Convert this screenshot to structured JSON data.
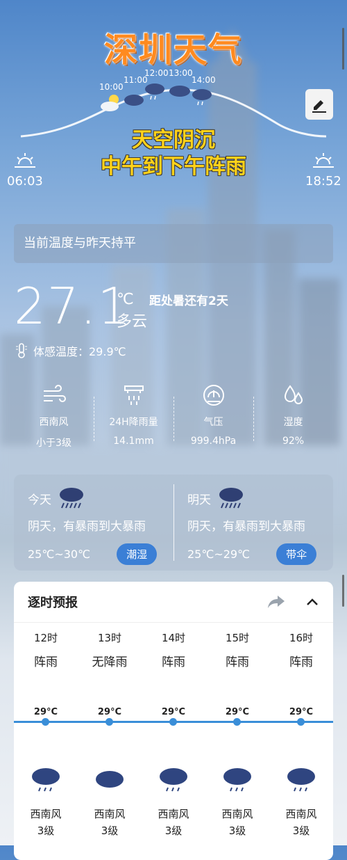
{
  "banner": {
    "title": "深圳天气",
    "headline_line1": "天空阴沉",
    "headline_line2": "中午到下午阵雨"
  },
  "timeline": [
    "10:00",
    "11:00",
    "12:00",
    "13:00",
    "14:00"
  ],
  "sun": {
    "sunrise": "06:03",
    "sunset": "18:52"
  },
  "compare_text": "当前温度与昨天持平",
  "current": {
    "temperature": "27.1",
    "unit": "℃",
    "condition": "多云",
    "solar_term": "距处暑还有2天",
    "feels_like": "体感温度：29.9℃"
  },
  "metrics": [
    {
      "label": "西南风",
      "value": "小于3级",
      "icon": "wind-icon"
    },
    {
      "label": "24H降雨量",
      "value": "14.1mm",
      "icon": "rain-gauge-icon"
    },
    {
      "label": "气压",
      "value": "999.4hPa",
      "icon": "pressure-gauge-icon"
    },
    {
      "label": "湿度",
      "value": "92%",
      "icon": "humidity-drops-icon"
    }
  ],
  "days": [
    {
      "name": "今天",
      "desc": "阴天，有暴雨到大暴雨",
      "range": "25℃~30℃",
      "tag": "潮湿",
      "icon": "heavy-rain-icon"
    },
    {
      "name": "明天",
      "desc": "阴天，有暴雨到大暴雨",
      "range": "25℃~29℃",
      "tag": "带伞",
      "icon": "heavy-rain-icon"
    }
  ],
  "hourly": {
    "title": "逐时预报",
    "items": [
      {
        "time": "12时",
        "cond": "阵雨",
        "temp": "29°C",
        "wind": "西南风",
        "level": "3级",
        "icon": "rain-cloud-icon"
      },
      {
        "time": "13时",
        "cond": "无降雨",
        "temp": "29°C",
        "wind": "西南风",
        "level": "3级",
        "icon": "cloud-icon"
      },
      {
        "time": "14时",
        "cond": "阵雨",
        "temp": "29°C",
        "wind": "西南风",
        "level": "3级",
        "icon": "rain-cloud-icon"
      },
      {
        "time": "15时",
        "cond": "阵雨",
        "temp": "29°C",
        "wind": "西南风",
        "level": "3级",
        "icon": "rain-cloud-icon"
      },
      {
        "time": "16时",
        "cond": "阵雨",
        "temp": "29°C",
        "wind": "西南风",
        "level": "3级",
        "icon": "rain-cloud-icon"
      }
    ]
  },
  "colors": {
    "accent": "#3b7fd6",
    "headline": "#ffd21a",
    "title": "#ff8a1f"
  }
}
